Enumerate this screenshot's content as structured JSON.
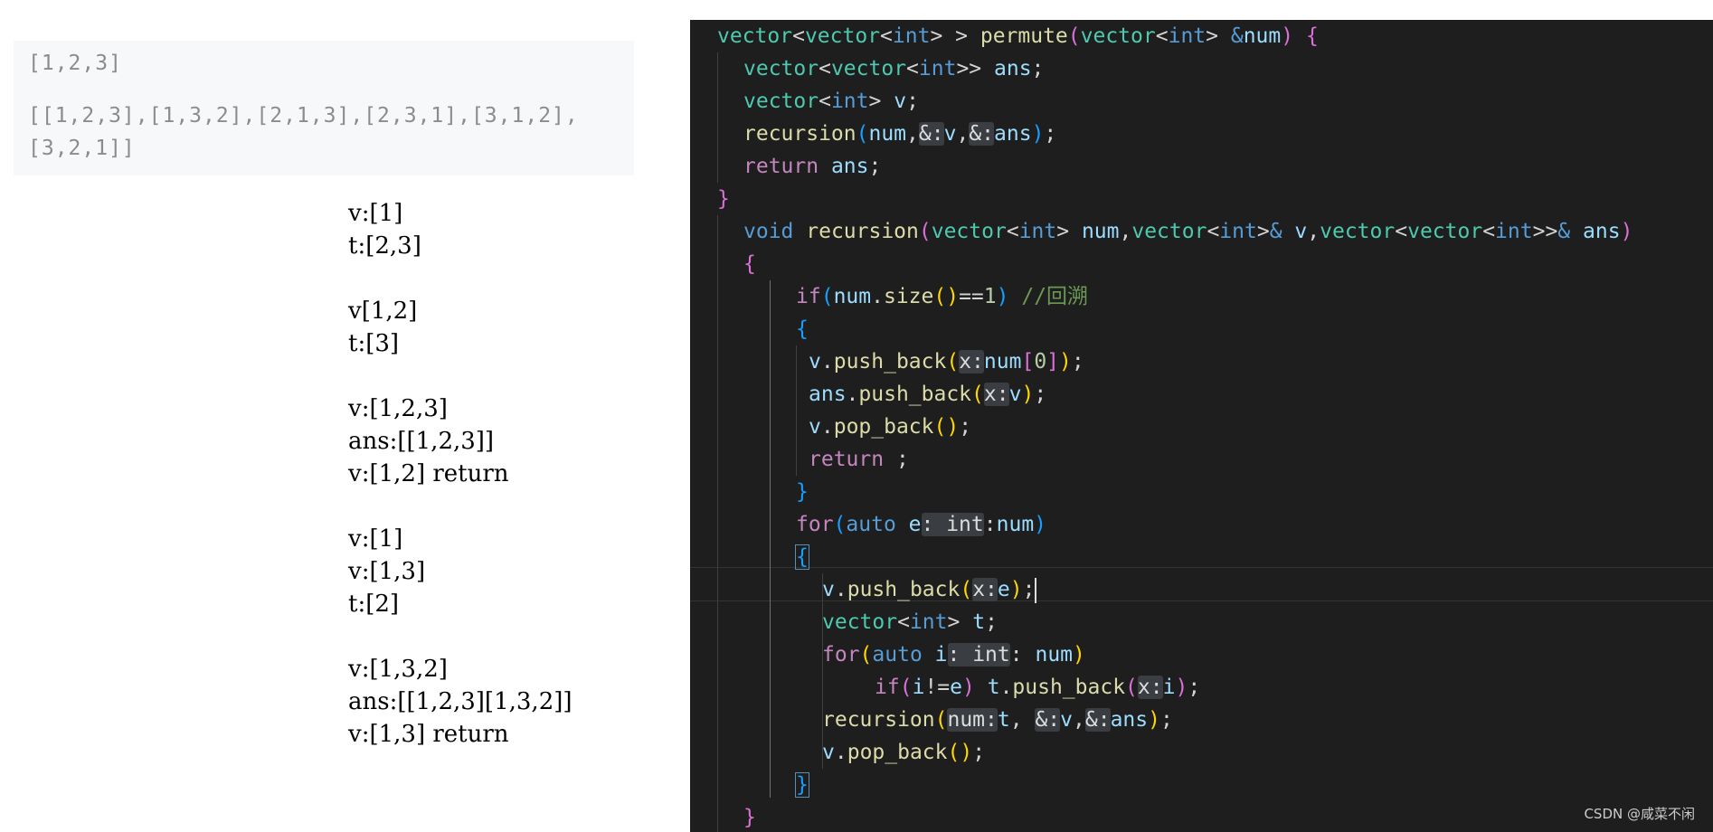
{
  "example": {
    "input": "[1,2,3]",
    "output_line1": "[[1,2,3],[1,3,2],[2,1,3],[2,3,1],[3,1,2],",
    "output_line2": "[3,2,1]]"
  },
  "trace": [
    [
      "v:[1]",
      "t:[2,3]"
    ],
    [
      "v[1,2]",
      "t:[3]"
    ],
    [
      "v:[1,2,3]",
      "ans:[[1,2,3]]",
      "v:[1,2] return"
    ],
    [
      "v:[1]",
      "v:[1,3]",
      "t:[2]"
    ],
    [
      "v:[1,3,2]",
      "ans:[[1,2,3][1,3,2]]",
      "v:[1,3] return"
    ]
  ],
  "code": {
    "inlay_ampersand": "&:",
    "inlay_x": "x:",
    "inlay_num": "num:",
    "inlay_int": ": int"
  },
  "watermark": "CSDN @咸菜不闲",
  "colors": {
    "editor_bg": "#1e1e1e",
    "type": "#4ec9b0",
    "keyword": "#569cd6",
    "control": "#c586c0",
    "function": "#dcdcaa",
    "variable": "#9cdcfe",
    "comment": "#6a9955"
  }
}
